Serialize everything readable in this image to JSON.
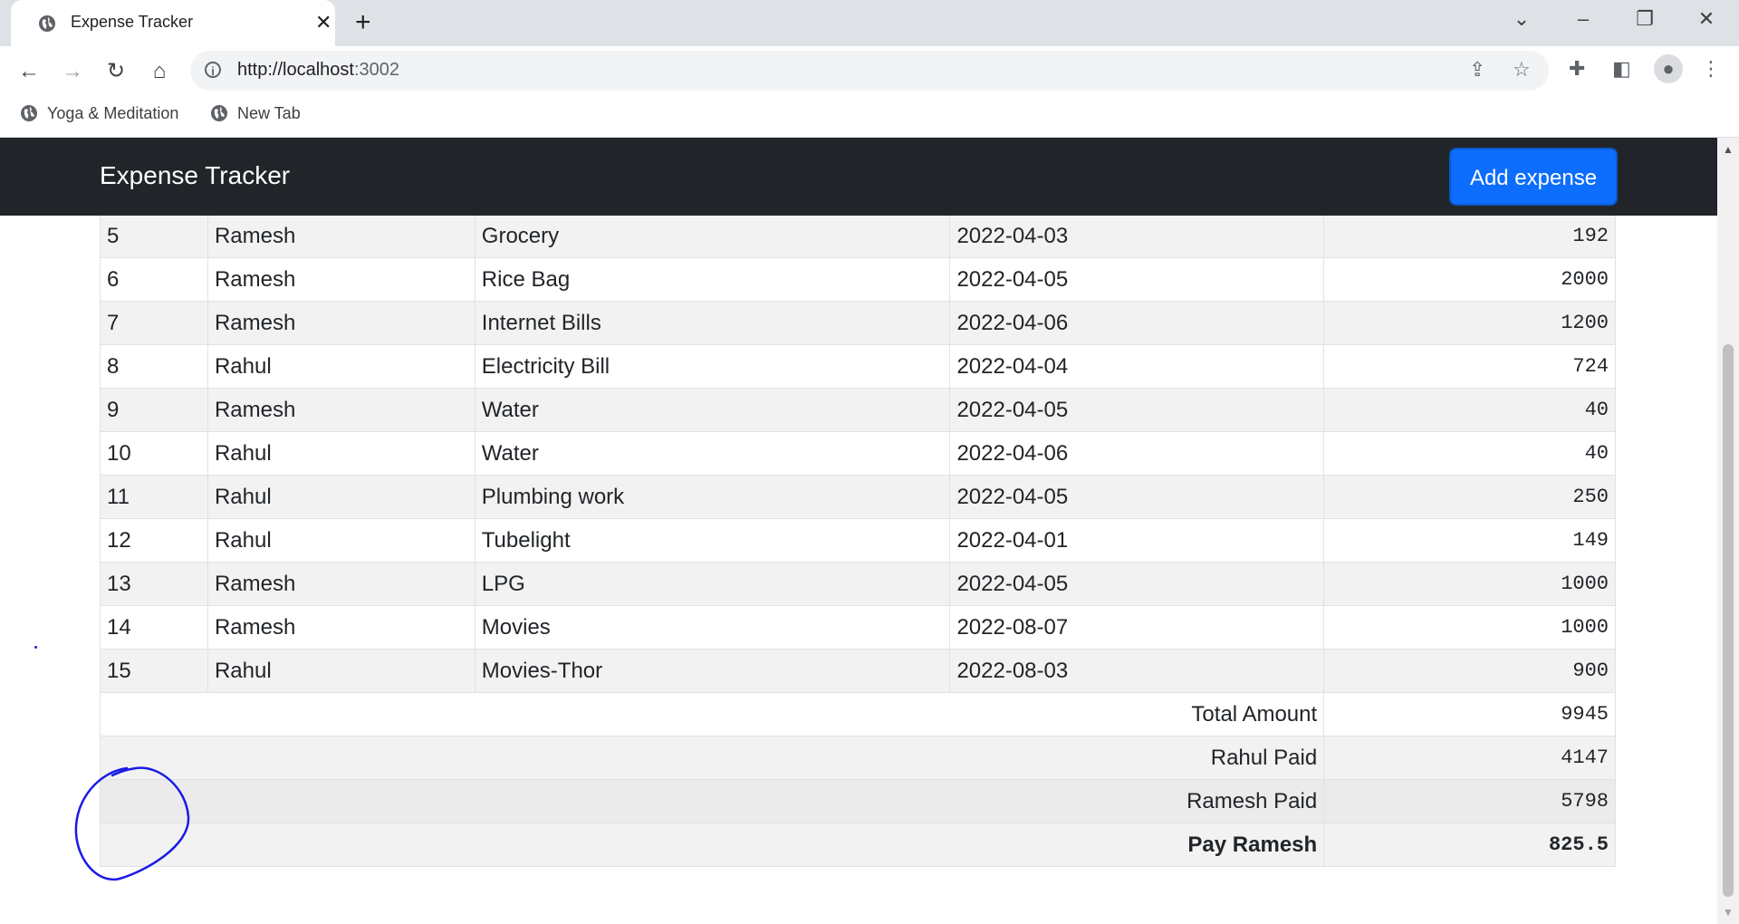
{
  "browser": {
    "tab_title": "Expense Tracker",
    "url_host": "http://localhost",
    "url_port": ":3002",
    "bookmarks": [
      "Yoga & Meditation",
      "New Tab"
    ]
  },
  "app": {
    "brand": "Expense Tracker",
    "add_button": "Add expense",
    "accent_color": "#0d6efd"
  },
  "expenses": [
    {
      "id": "5",
      "name": "Ramesh",
      "item": "Grocery",
      "date": "2022-04-03",
      "amount": "192"
    },
    {
      "id": "6",
      "name": "Ramesh",
      "item": "Rice Bag",
      "date": "2022-04-05",
      "amount": "2000"
    },
    {
      "id": "7",
      "name": "Ramesh",
      "item": "Internet Bills",
      "date": "2022-04-06",
      "amount": "1200"
    },
    {
      "id": "8",
      "name": "Rahul",
      "item": "Electricity Bill",
      "date": "2022-04-04",
      "amount": "724"
    },
    {
      "id": "9",
      "name": "Ramesh",
      "item": "Water",
      "date": "2022-04-05",
      "amount": "40"
    },
    {
      "id": "10",
      "name": "Rahul",
      "item": "Water",
      "date": "2022-04-06",
      "amount": "40"
    },
    {
      "id": "11",
      "name": "Rahul",
      "item": "Plumbing work",
      "date": "2022-04-05",
      "amount": "250"
    },
    {
      "id": "12",
      "name": "Rahul",
      "item": "Tubelight",
      "date": "2022-04-01",
      "amount": "149"
    },
    {
      "id": "13",
      "name": "Ramesh",
      "item": "LPG",
      "date": "2022-04-05",
      "amount": "1000"
    },
    {
      "id": "14",
      "name": "Ramesh",
      "item": "Movies",
      "date": "2022-08-07",
      "amount": "1000"
    },
    {
      "id": "15",
      "name": "Rahul",
      "item": "Movies-Thor",
      "date": "2022-08-03",
      "amount": "900"
    }
  ],
  "summary": {
    "total_label": "Total Amount",
    "total_value": "9945",
    "rahul_label": "Rahul Paid",
    "rahul_value": "4147",
    "ramesh_label": "Ramesh Paid",
    "ramesh_value": "5798",
    "pay_label": "Pay Ramesh",
    "pay_value": "825.5"
  },
  "icons": {
    "back": "arrow-left",
    "forward": "arrow-right",
    "reload": "reload",
    "home": "home",
    "share": "share",
    "star": "star",
    "extensions": "puzzle",
    "sidepanel": "side-panel",
    "profile": "person",
    "menu": "kebab"
  }
}
